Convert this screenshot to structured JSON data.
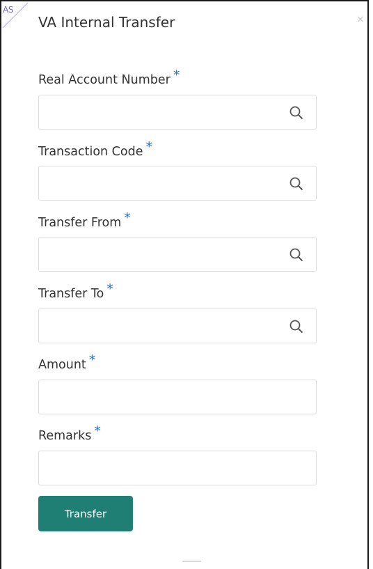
{
  "corner_badge": "AS",
  "dialog": {
    "title": "VA Internal Transfer",
    "close_symbol": "×"
  },
  "required_marker": "*",
  "fields": [
    {
      "label": "Real Account Number",
      "value": "",
      "has_lookup": true
    },
    {
      "label": "Transaction Code",
      "value": "",
      "has_lookup": true
    },
    {
      "label": "Transfer From",
      "value": "",
      "has_lookup": true
    },
    {
      "label": "Transfer To",
      "value": "",
      "has_lookup": true
    },
    {
      "label": "Amount",
      "value": "",
      "has_lookup": false
    },
    {
      "label": "Remarks",
      "value": "",
      "has_lookup": false
    }
  ],
  "actions": {
    "transfer_label": "Transfer"
  },
  "colors": {
    "accent_button": "#1f7f74",
    "required_star": "#2b70c2",
    "corner_badge": "#7a63c9"
  }
}
